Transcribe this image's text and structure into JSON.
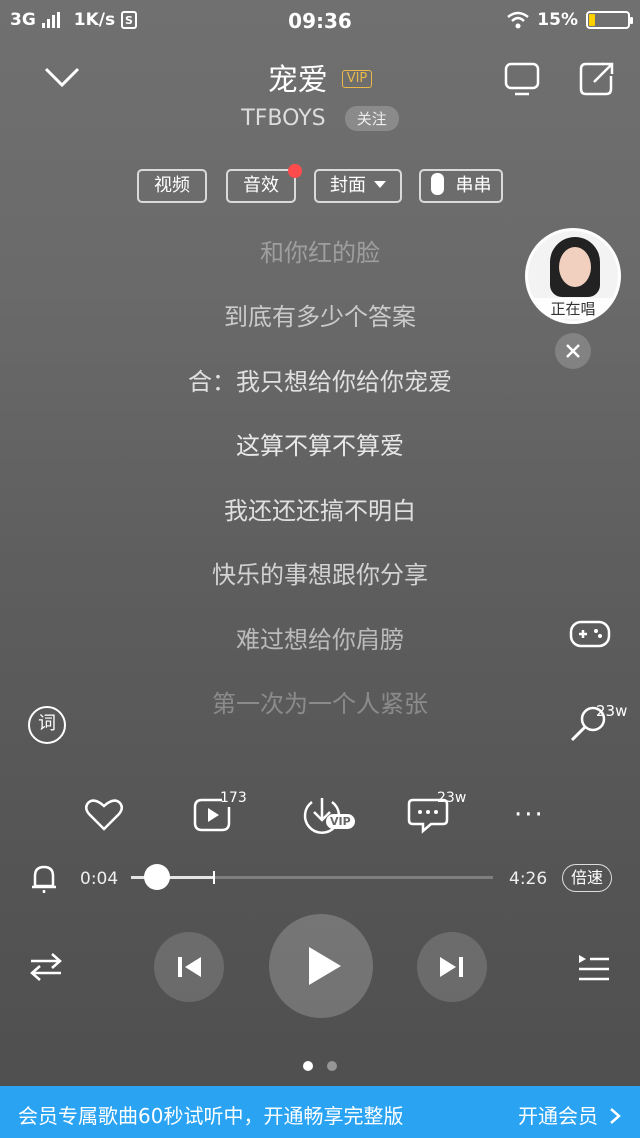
{
  "status": {
    "network": "3G",
    "speed": "1K/s",
    "time": "09:36",
    "battery": "15%",
    "battery_level": 0.15
  },
  "song": {
    "title": "宠爱",
    "vip_badge": "VIP",
    "artist": "TFBOYS",
    "follow_label": "关注"
  },
  "chips": {
    "video": "视频",
    "sound": "音效",
    "cover": "封面",
    "chain": "串串"
  },
  "lyrics": [
    "和你红的脸",
    "到底有多少个答案",
    "合：我只想给你给你宠爱",
    "这算不算不算爱",
    "我还还还搞不明白",
    "快乐的事想跟你分享",
    "难过想给你肩膀",
    "第一次为一个人紧张"
  ],
  "singing": {
    "label": "正在唱"
  },
  "side": {
    "lyric_icon_label": "词",
    "mic_count": "23w"
  },
  "actions": {
    "playlist_count": "173",
    "comment_count": "23w",
    "download_badge": "VIP",
    "more": "···"
  },
  "progress": {
    "current": "0:04",
    "total": "4:26",
    "played_fraction": 0.016,
    "buffered_fraction": 0.23,
    "speed_label": "倍速"
  },
  "pager": {
    "count": 2,
    "active": 0
  },
  "banner": {
    "text": "会员专属歌曲60秒试听中，开通畅享完整版",
    "action": "开通会员"
  },
  "colors": {
    "vip": "#e8b84a",
    "banner": "#2aa3f3",
    "badge_dot": "#ff4b4b",
    "battery": "#ffd200"
  }
}
